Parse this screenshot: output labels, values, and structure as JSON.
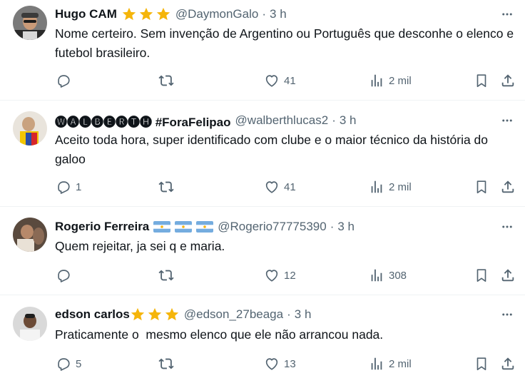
{
  "replies": [
    {
      "name": "Hugo CAM",
      "badge_type": "stars",
      "handle": "@DaymonGalo",
      "separator": "·",
      "time": "3 h",
      "text": "Nome certeiro. Sem invenção de Argentino ou Português que desconhe o elenco e futebol brasileiro.",
      "replies_count": "",
      "likes": "41",
      "views": "2 mil"
    },
    {
      "name": "🅦🅐🅛🅑🅔🅡🅣🅗 #ForaFelipao",
      "badge_type": "none",
      "handle": "@walberthlucas2",
      "separator": "·",
      "time": "3 h",
      "text": "Aceito toda hora, super identificado com clube e o maior técnico da história do galoo",
      "replies_count": "1",
      "likes": "41",
      "views": "2 mil"
    },
    {
      "name": "Rogerio Ferreira",
      "badge_type": "flags",
      "handle": "@Rogerio77775390",
      "separator": "·",
      "time": "3 h",
      "text": "Quem rejeitar, ja sei q e maria.",
      "replies_count": "",
      "likes": "12",
      "views": "308"
    },
    {
      "name": "edson carlos",
      "badge_type": "stars",
      "handle": "@edson_27beaga",
      "separator": "·",
      "time": "3 h",
      "text": "Praticamente o  mesmo elenco que ele não arrancou nada.",
      "replies_count": "5",
      "likes": "13",
      "views": "2 mil"
    }
  ],
  "colors": {
    "text": "#0f1419",
    "secondary": "#536471",
    "star": "#f5b50a",
    "flag_blue": "#74acdf",
    "divider": "#eff3f4"
  },
  "icons": [
    "reply-icon",
    "retweet-icon",
    "like-icon",
    "views-icon",
    "bookmark-icon",
    "share-icon",
    "more-icon",
    "star-icon",
    "argentina-flag-icon"
  ]
}
